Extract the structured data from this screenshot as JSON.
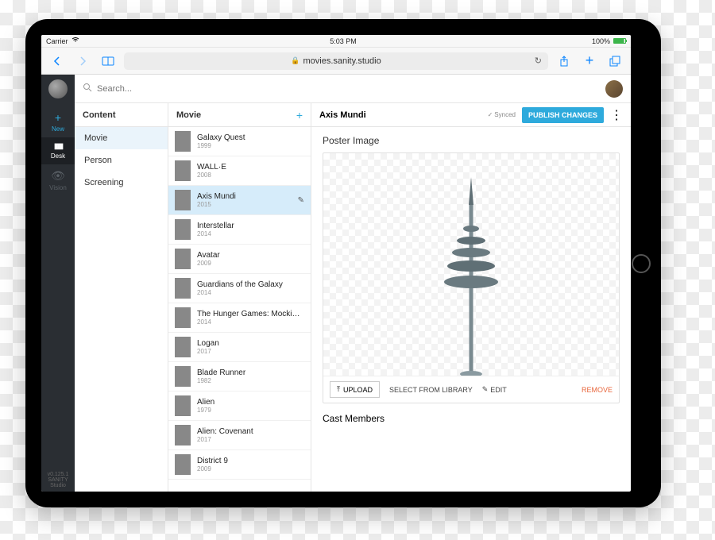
{
  "statusbar": {
    "carrier": "Carrier",
    "time": "5:03 PM",
    "battery": "100%"
  },
  "safari": {
    "url": "movies.sanity.studio"
  },
  "rail": {
    "items": [
      {
        "icon": "+",
        "label": "New"
      },
      {
        "icon": "▮▮▮",
        "label": "Desk"
      },
      {
        "icon": "👁",
        "label": "Vision"
      }
    ],
    "version": "v0.125.1",
    "brand": "SANITY Studio"
  },
  "search": {
    "placeholder": "Search..."
  },
  "content": {
    "header": "Content",
    "items": [
      "Movie",
      "Person",
      "Screening"
    ],
    "selected": 0
  },
  "movies": {
    "header": "Movie",
    "selected": 2,
    "items": [
      {
        "title": "Galaxy Quest",
        "year": "1999"
      },
      {
        "title": "WALL·E",
        "year": "2008"
      },
      {
        "title": "Axis Mundi",
        "year": "2015"
      },
      {
        "title": "Interstellar",
        "year": "2014"
      },
      {
        "title": "Avatar",
        "year": "2009"
      },
      {
        "title": "Guardians of the Galaxy",
        "year": "2014"
      },
      {
        "title": "The Hunger Games: Mockin…",
        "year": "2014"
      },
      {
        "title": "Logan",
        "year": "2017"
      },
      {
        "title": "Blade Runner",
        "year": "1982"
      },
      {
        "title": "Alien",
        "year": "1979"
      },
      {
        "title": "Alien: Covenant",
        "year": "2017"
      },
      {
        "title": "District 9",
        "year": "2009"
      }
    ]
  },
  "editor": {
    "title": "Axis Mundi",
    "sync": "Synced",
    "publish": "PUBLISH CHANGES",
    "poster_label": "Poster Image",
    "upload": "UPLOAD",
    "library": "SELECT FROM LIBRARY",
    "edit": "EDIT",
    "remove": "REMOVE",
    "cast_label": "Cast Members"
  }
}
